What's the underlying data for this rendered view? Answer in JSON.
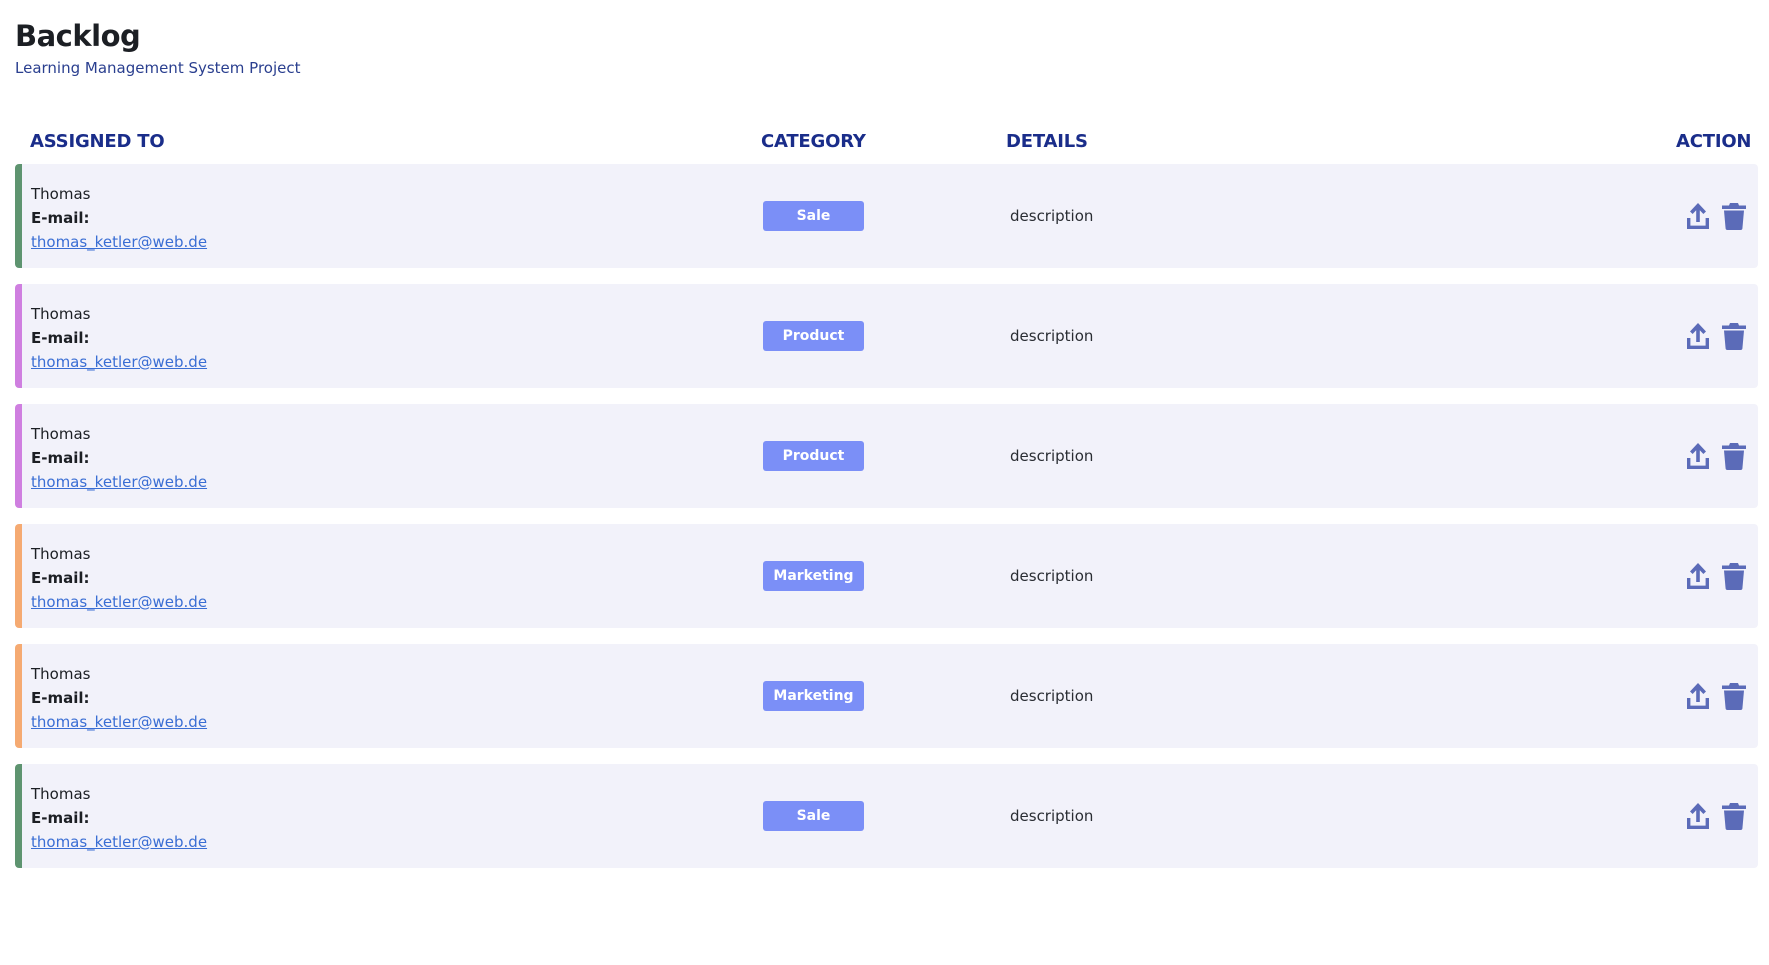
{
  "header": {
    "title": "Backlog",
    "subtitle": "Learning Management System Project"
  },
  "columns": {
    "assigned_to": "ASSIGNED TO",
    "category": "CATEGORY",
    "details": "DETAILS",
    "action": "ACTION"
  },
  "rows": [
    {
      "name": "Thomas",
      "email_label": "E-mail:",
      "email": "thomas_ketler@web.de",
      "category": "Sale",
      "details": "description"
    },
    {
      "name": "Thomas",
      "email_label": "E-mail:",
      "email": "thomas_ketler@web.de",
      "category": "Product",
      "details": "description"
    },
    {
      "name": "Thomas",
      "email_label": "E-mail:",
      "email": "thomas_ketler@web.de",
      "category": "Product",
      "details": "description"
    },
    {
      "name": "Thomas",
      "email_label": "E-mail:",
      "email": "thomas_ketler@web.de",
      "category": "Marketing",
      "details": "description"
    },
    {
      "name": "Thomas",
      "email_label": "E-mail:",
      "email": "thomas_ketler@web.de",
      "category": "Marketing",
      "details": "description"
    },
    {
      "name": "Thomas",
      "email_label": "E-mail:",
      "email": "thomas_ketler@web.de",
      "category": "Sale",
      "details": "description"
    }
  ],
  "category_colors": {
    "Sale": "#5e9470",
    "Product": "#cf7fe0",
    "Marketing": "#f5aa72"
  },
  "badge_color": "#7b8ff7",
  "icon_color": "#5b6bb8",
  "icons": {
    "upload": "upload-icon",
    "delete": "trash-icon"
  }
}
